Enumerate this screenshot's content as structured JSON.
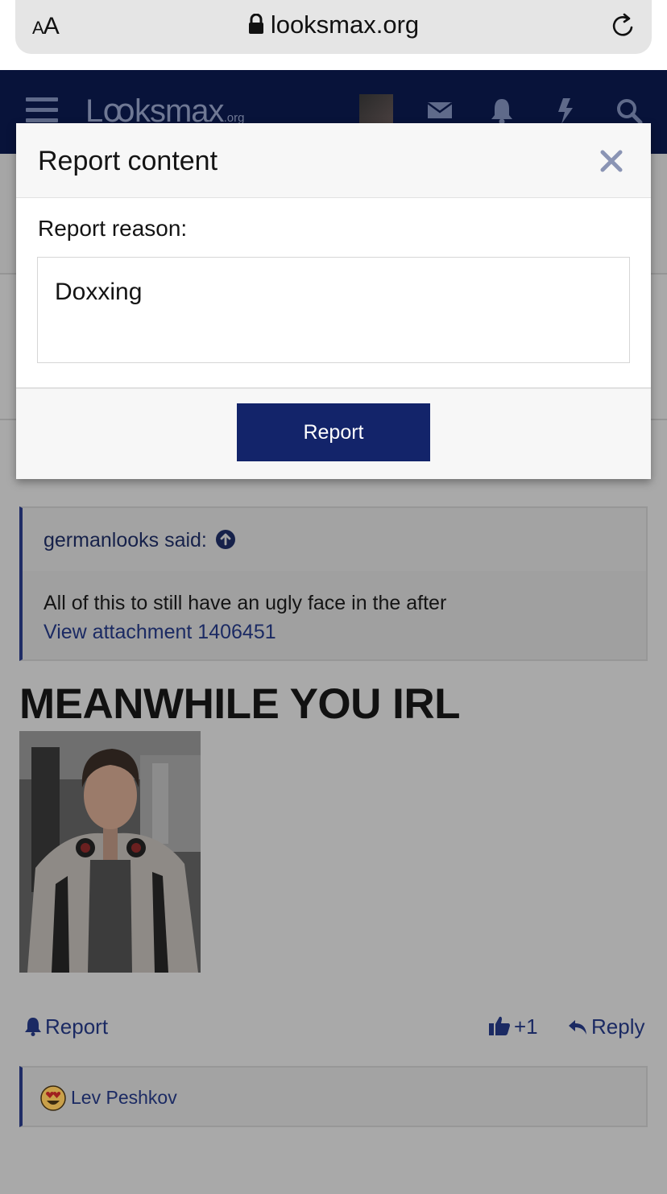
{
  "browser": {
    "text_size_label": "AA",
    "url": "looksmax.org"
  },
  "site": {
    "logo_main": "Lꝏksmax",
    "logo_suffix": ".org"
  },
  "modal": {
    "title": "Report content",
    "reason_label": "Report reason:",
    "reason_value": "Doxxing",
    "submit_label": "Report"
  },
  "post": {
    "quote_author_line": "germanlooks said:",
    "quote_text": "All of this to still have an ugly face in the after",
    "quote_attachment": "View attachment 1406451",
    "body_text": "MEANWHILE YOU IRL",
    "actions": {
      "report_label": "Report",
      "like_count": "+1",
      "reply_label": "Reply"
    },
    "reactions": {
      "user": "Lev Peshkov"
    }
  },
  "colors": {
    "brand_navy": "#13246a",
    "header_bg": "#08133a",
    "link": "#1b2a63"
  }
}
